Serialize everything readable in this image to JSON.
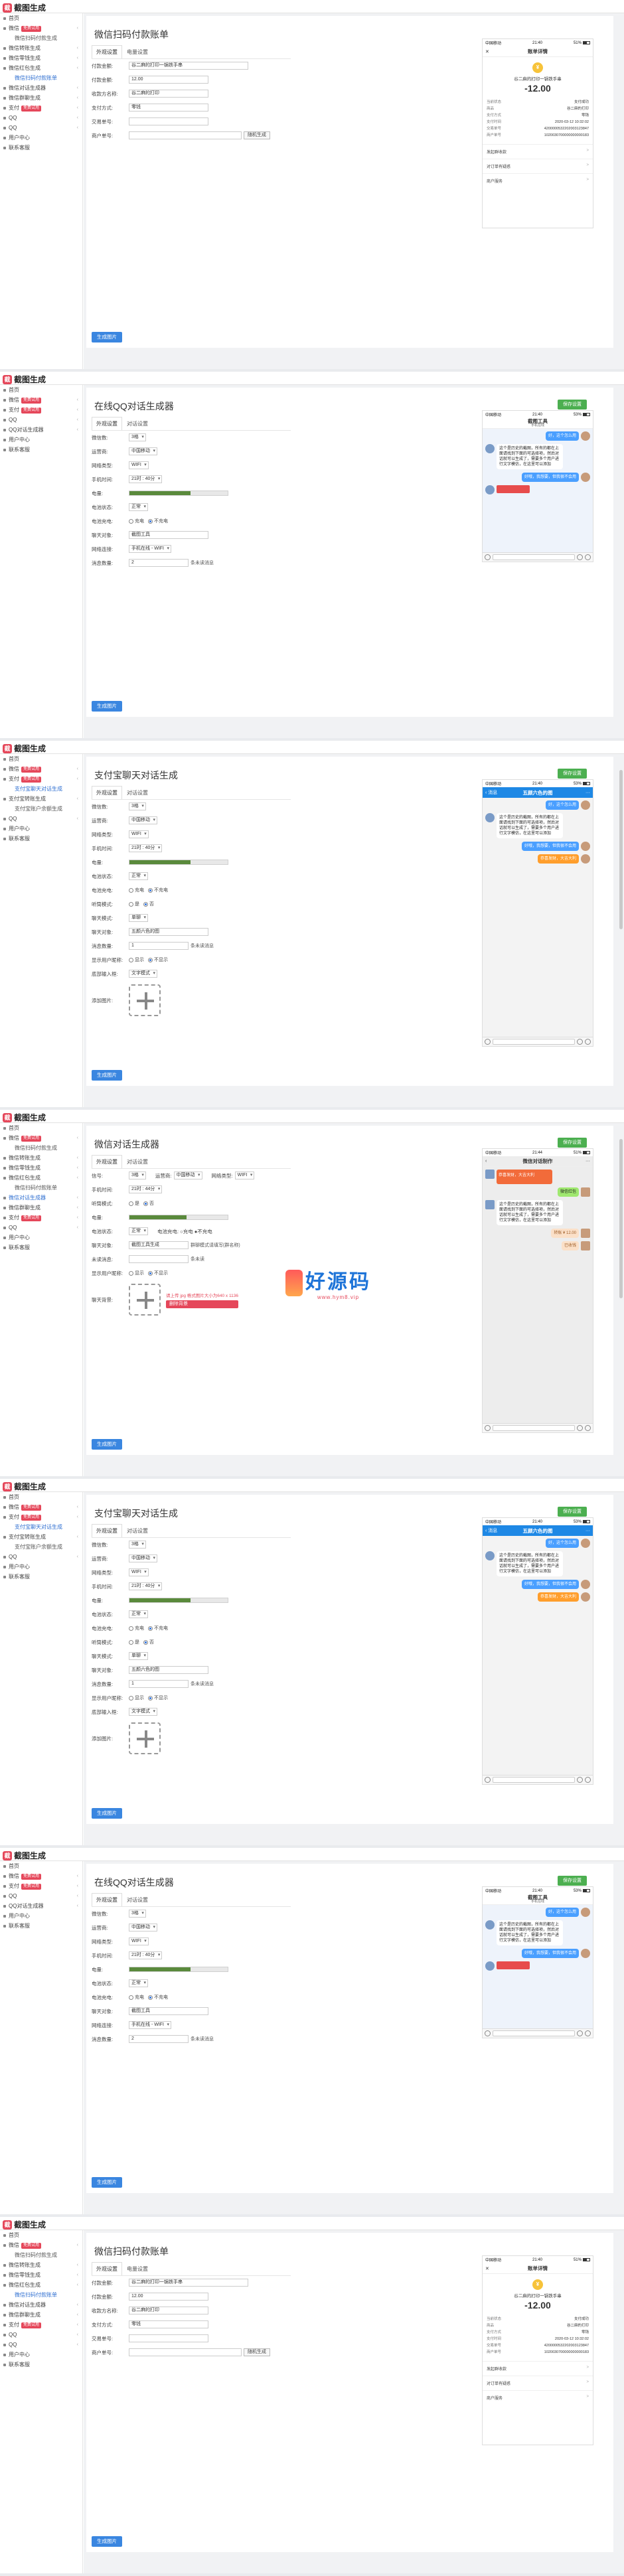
{
  "app": {
    "logo_text": "截图生成",
    "logo_mark": "截"
  },
  "colors": {
    "accent": "#3a86e0",
    "badge": "#e5475a",
    "save": "#4caf50"
  },
  "panels": [
    {
      "title": "微信扫码付款账单",
      "tabs": [
        "外观设置",
        "电量设置"
      ],
      "sidebar": [
        "首页",
        "微信 免费试用",
        "微信扫码付款生成",
        "微信转账生成",
        "微信零钱生成",
        "微信红包生成",
        "微信扫码付款账单",
        "微信对话生成器",
        "微信群聊生成",
        "支付 免费试用",
        "QQ",
        "QQ",
        "用户中心",
        "联系客服"
      ],
      "form": [
        {
          "label": "付款金额:",
          "value": "谷二麻的打印一锅铁手串"
        },
        {
          "label": "付款金额:",
          "value": "12.00"
        },
        {
          "label": "收款方名称:",
          "value": "谷二麻的打印"
        },
        {
          "label": "支付方式:",
          "value": "零钱"
        },
        {
          "label": "交易单号:",
          "value": ""
        },
        {
          "label": "商户单号:",
          "value": "",
          "button": "随机生成"
        }
      ],
      "generate": "生成图片",
      "phone": {
        "time": "21:40",
        "carrier": "中国移动",
        "battery": "51%",
        "battery_level": 0.51,
        "title": "账单详情",
        "shop": "谷二麻的打印一锅铁手串",
        "amount": "-12.00",
        "details": [
          [
            "当前状态",
            "支付成功"
          ],
          [
            "商品",
            "谷二麻的打印"
          ],
          [
            "支付方式",
            "零钱"
          ],
          [
            "支付时间",
            "2020-03-12 10:32:02"
          ],
          [
            "交易单号",
            "4200000532202003123847"
          ],
          [
            "商户单号",
            "1020030700000000000183"
          ]
        ],
        "rows": [
          [
            "发起群收款",
            ">"
          ],
          [
            "对订单有疑惑",
            ">"
          ],
          [
            "商户服务",
            ">"
          ]
        ]
      }
    },
    {
      "title": "在线QQ对话生成器",
      "save": "保存设置",
      "tabs": [
        "外观设置",
        "对话设置"
      ],
      "sidebar": [
        "首页",
        "微信 免费试用",
        "支付 免费试用",
        "QQ",
        "QQ对话生成器",
        "用户中心",
        "联系客服"
      ],
      "form": [
        {
          "label": "微信数:",
          "select": "3格"
        },
        {
          "label": "运营商:",
          "select": "中国移动"
        },
        {
          "label": "网络类型:",
          "select": "WIFI"
        },
        {
          "label": "手机时间:",
          "select": "21时 : 40分"
        },
        {
          "label": "电量:",
          "slider": 0.62
        },
        {
          "label": "电池状态:",
          "select": "正常"
        },
        {
          "label": "电池充电:",
          "radios": [
            "充电",
            "不充电"
          ],
          "on": 1
        },
        {
          "label": "聊天对象:",
          "value": "截图工具"
        },
        {
          "label": "网络连接:",
          "select": "手机在线 - WIFI"
        },
        {
          "label": "消息数量:",
          "value": "2",
          "unit": "条未读消息"
        }
      ],
      "generate": "生成图片",
      "phone": {
        "time": "21:40",
        "carrier": "中国移动",
        "battery": "53%",
        "battery_level": 0.53,
        "title": "截图工具",
        "subtitle": "手机在线",
        "msgs": [
          {
            "side": "right",
            "text": "好，这个怎么用",
            "color": "blue"
          },
          {
            "side": "left",
            "text": "这个是历史的截图，所有的都在上面请找到下面的可选择项，然后对话就可以生成了，需要多个用户进行文字模仿，在这里可以添加"
          },
          {
            "side": "right",
            "text": "好哦，我想要，但我很不会用",
            "color": "blue"
          }
        ]
      }
    },
    {
      "title": "支付宝聊天对话生成",
      "save": "保存设置",
      "tabs": [
        "外观设置",
        "对话设置"
      ],
      "sidebar": [
        "首页",
        "微信 免费试用",
        "支付 免费试用",
        "支付宝聊天对话生成",
        "支付宝转账生成",
        "支付宝账户余额生成",
        "QQ",
        "用户中心",
        "联系客服"
      ],
      "form": [
        {
          "label": "微信数:",
          "select": "3格"
        },
        {
          "label": "运营商:",
          "select": "中国移动"
        },
        {
          "label": "网络类型:",
          "select": "WIFI"
        },
        {
          "label": "手机时间:",
          "select": "21时 : 40分"
        },
        {
          "label": "电量:",
          "slider": 0.62
        },
        {
          "label": "电池状态:",
          "select": "正常"
        },
        {
          "label": "电池充电:",
          "radios": [
            "充电",
            "不充电"
          ],
          "on": 1
        },
        {
          "label": "听筒模式:",
          "radios": [
            "是",
            "否"
          ],
          "on": 1
        },
        {
          "label": "聊天模式:",
          "select": "单聊"
        },
        {
          "label": "聊天对象:",
          "value": "五颜六色的图"
        },
        {
          "label": "消息数量:",
          "value": "1",
          "unit": "条未读消息"
        },
        {
          "label": "显示用户昵称:",
          "radios": [
            "显示",
            "不显示"
          ],
          "on": 1
        },
        {
          "label": "底部输入框:",
          "select": "文字模式"
        },
        {
          "label": "添加图片:",
          "upload": true
        }
      ],
      "generate": "生成图片",
      "phone": {
        "time": "21:40",
        "carrier": "中国移动",
        "battery": "53%",
        "battery_level": 0.53,
        "title": "五颜六色的图",
        "back": "‹ 消息",
        "more": "···",
        "msgs": [
          {
            "side": "right",
            "text": "好，这个怎么用",
            "color": "blue"
          },
          {
            "side": "left",
            "text": "这个是历史的截图，所有的都在上面请找到下面的可选择项，然后对话就可以生成了，需要多个用户进行文字模仿，在这里可以添加"
          },
          {
            "side": "right",
            "text": "好哦，我想要，但我很不会用",
            "color": "blue"
          },
          {
            "side": "right",
            "text": "恭喜发财，大吉大利",
            "color": "orange"
          }
        ]
      }
    },
    {
      "title": "微信对话生成器",
      "save": "保存设置",
      "tabs": [
        "外观设置",
        "对话设置"
      ],
      "sidebar": [
        "首页",
        "微信 免费试用",
        "微信扫码付款生成",
        "微信转账生成",
        "微信零钱生成",
        "微信红包生成",
        "微信扫码付款账单",
        "微信对话生成器",
        "微信群聊生成",
        "支付 免费试用",
        "QQ",
        "用户中心",
        "联系客服"
      ],
      "form": [
        {
          "label": "信号:",
          "select": "3格",
          "extra": [
            [
              "运营商:",
              "中国移动"
            ],
            [
              "网络类型:",
              "WIFI"
            ]
          ]
        },
        {
          "label": "手机时间:",
          "select": "21时 : 44分"
        },
        {
          "label": "听筒模式:",
          "radios": [
            "是",
            "否"
          ],
          "on": 1
        },
        {
          "label": "电量:",
          "slider": 0.58
        },
        {
          "label": "电池状态:",
          "select": "正常",
          "extra2": "电池充电:  ○充电  ●不充电"
        },
        {
          "label": "聊天对象:",
          "value": "截图工具生成",
          "unit": "群聊模式请填写(群名称)"
        },
        {
          "label": "未读消息:",
          "value": "",
          "unit": "条未读"
        },
        {
          "label": "显示用户昵称:",
          "radios": [
            "显示",
            "不显示"
          ],
          "on": 1
        },
        {
          "label": "聊天背景:",
          "upload": true,
          "note": "请上传 jpg 格式图片大小为640 x 1136",
          "button": "删除背景"
        }
      ],
      "generate": "生成图片",
      "watermark": {
        "text": "好源码",
        "url": "www.hym8.vip"
      },
      "phone": {
        "time": "21:44",
        "carrier": "中国移动",
        "battery": "51%",
        "battery_level": 0.51,
        "title": "微信对话制作",
        "back": "‹",
        "more": "···",
        "msgs": [
          {
            "side": "left",
            "redpk": "恭喜发财，大吉大利"
          },
          {
            "side": "right",
            "text": "微信红包",
            "color": "green"
          },
          {
            "side": "left",
            "text": "这个是历史的截图，所有的都在上面请找到下面的可选择项，然后对话就可以生成了，需要多个用户进行文字模仿，在这里可以添加"
          },
          {
            "side": "right",
            "text": "转账 ¥ 12.00",
            "color": "pink"
          },
          {
            "side": "right",
            "text": "已收钱",
            "color": "pink"
          }
        ]
      }
    },
    {
      "title": "支付宝聊天对话生成",
      "save": "保存设置",
      "tabs": [
        "外观设置",
        "对话设置"
      ],
      "sidebar": [
        "首页",
        "微信 免费试用",
        "支付 免费试用",
        "支付宝聊天对话生成",
        "支付宝转账生成",
        "支付宝账户余额生成",
        "QQ",
        "用户中心",
        "联系客服"
      ],
      "form": [
        {
          "label": "微信数:",
          "select": "3格"
        },
        {
          "label": "运营商:",
          "select": "中国移动"
        },
        {
          "label": "网络类型:",
          "select": "WIFI"
        },
        {
          "label": "手机时间:",
          "select": "21时 : 40分"
        },
        {
          "label": "电量:",
          "slider": 0.62
        },
        {
          "label": "电池状态:",
          "select": "正常"
        },
        {
          "label": "电池充电:",
          "radios": [
            "充电",
            "不充电"
          ],
          "on": 1
        },
        {
          "label": "听筒模式:",
          "radios": [
            "是",
            "否"
          ],
          "on": 1
        },
        {
          "label": "聊天模式:",
          "select": "单聊"
        },
        {
          "label": "聊天对象:",
          "value": "五颜六色的图"
        },
        {
          "label": "消息数量:",
          "value": "1",
          "unit": "条未读消息"
        },
        {
          "label": "显示用户昵称:",
          "radios": [
            "显示",
            "不显示"
          ],
          "on": 1
        },
        {
          "label": "底部输入框:",
          "select": "文字模式"
        },
        {
          "label": "添加图片:",
          "upload": true
        }
      ],
      "generate": "生成图片",
      "phone": {
        "time": "21:40",
        "carrier": "中国移动",
        "battery": "53%",
        "battery_level": 0.53,
        "title": "五颜六色的图",
        "back": "‹ 消息",
        "more": "···",
        "msgs": [
          {
            "side": "right",
            "text": "好，这个怎么用",
            "color": "blue"
          },
          {
            "side": "left",
            "text": "这个是历史的截图，所有的都在上面请找到下面的可选择项，然后对话就可以生成了，需要多个用户进行文字模仿，在这里可以添加"
          },
          {
            "side": "right",
            "text": "好哦，我想要，但我很不会用",
            "color": "blue"
          },
          {
            "side": "right",
            "text": "恭喜发财，大吉大利",
            "color": "orange"
          }
        ]
      }
    },
    {
      "title": "在线QQ对话生成器",
      "save": "保存设置",
      "tabs": [
        "外观设置",
        "对话设置"
      ],
      "sidebar": [
        "首页",
        "微信 免费试用",
        "支付 免费试用",
        "QQ",
        "QQ对话生成器",
        "用户中心",
        "联系客服"
      ],
      "form": [
        {
          "label": "微信数:",
          "select": "3格"
        },
        {
          "label": "运营商:",
          "select": "中国移动"
        },
        {
          "label": "网络类型:",
          "select": "WIFI"
        },
        {
          "label": "手机时间:",
          "select": "21时 : 40分"
        },
        {
          "label": "电量:",
          "slider": 0.62
        },
        {
          "label": "电池状态:",
          "select": "正常"
        },
        {
          "label": "电池充电:",
          "radios": [
            "充电",
            "不充电"
          ],
          "on": 1
        },
        {
          "label": "聊天对象:",
          "value": "截图工具"
        },
        {
          "label": "网络连接:",
          "select": "手机在线 - WIFI"
        },
        {
          "label": "消息数量:",
          "value": "2",
          "unit": "条未读消息"
        }
      ],
      "generate": "生成图片",
      "phone": {
        "time": "21:40",
        "carrier": "中国移动",
        "battery": "53%",
        "battery_level": 0.53,
        "title": "截图工具",
        "subtitle": "手机在线",
        "msgs": [
          {
            "side": "right",
            "text": "好，这个怎么用",
            "color": "blue"
          },
          {
            "side": "left",
            "text": "这个是历史的截图，所有的都在上面请找到下面的可选择项，然后对话就可以生成了，需要多个用户进行文字模仿，在这里可以添加"
          },
          {
            "side": "right",
            "text": "好哦，我想要，但我很不会用",
            "color": "blue"
          }
        ]
      }
    },
    {
      "title": "微信扫码付款账单",
      "tabs": [
        "外观设置",
        "电量设置"
      ],
      "sidebar": [
        "首页",
        "微信 免费试用",
        "微信扫码付款生成",
        "微信转账生成",
        "微信零钱生成",
        "微信红包生成",
        "微信扫码付款账单",
        "微信对话生成器",
        "微信群聊生成",
        "支付 免费试用",
        "QQ",
        "QQ",
        "用户中心",
        "联系客服"
      ],
      "form": [
        {
          "label": "付款金额:",
          "value": "谷二麻的打印一锅铁手串"
        },
        {
          "label": "付款金额:",
          "value": "12.00"
        },
        {
          "label": "收款方名称:",
          "value": "谷二麻的打印"
        },
        {
          "label": "支付方式:",
          "value": "零钱"
        },
        {
          "label": "交易单号:",
          "value": ""
        },
        {
          "label": "商户单号:",
          "value": "",
          "button": "随机生成"
        }
      ],
      "generate": "生成图片",
      "phone": {
        "time": "21:40",
        "carrier": "中国移动",
        "battery": "51%",
        "battery_level": 0.51,
        "title": "账单详情",
        "shop": "谷二麻的打印一锅铁手串",
        "amount": "-12.00",
        "details": [
          [
            "当前状态",
            "支付成功"
          ],
          [
            "商品",
            "谷二麻的打印"
          ],
          [
            "支付方式",
            "零钱"
          ],
          [
            "支付时间",
            "2020-03-12 10:32:02"
          ],
          [
            "交易单号",
            "4200000532202003123847"
          ],
          [
            "商户单号",
            "1020030700000000000183"
          ]
        ],
        "rows": [
          [
            "发起群收款",
            ">"
          ],
          [
            "对订单有疑惑",
            ">"
          ],
          [
            "商户服务",
            ">"
          ]
        ]
      }
    }
  ]
}
